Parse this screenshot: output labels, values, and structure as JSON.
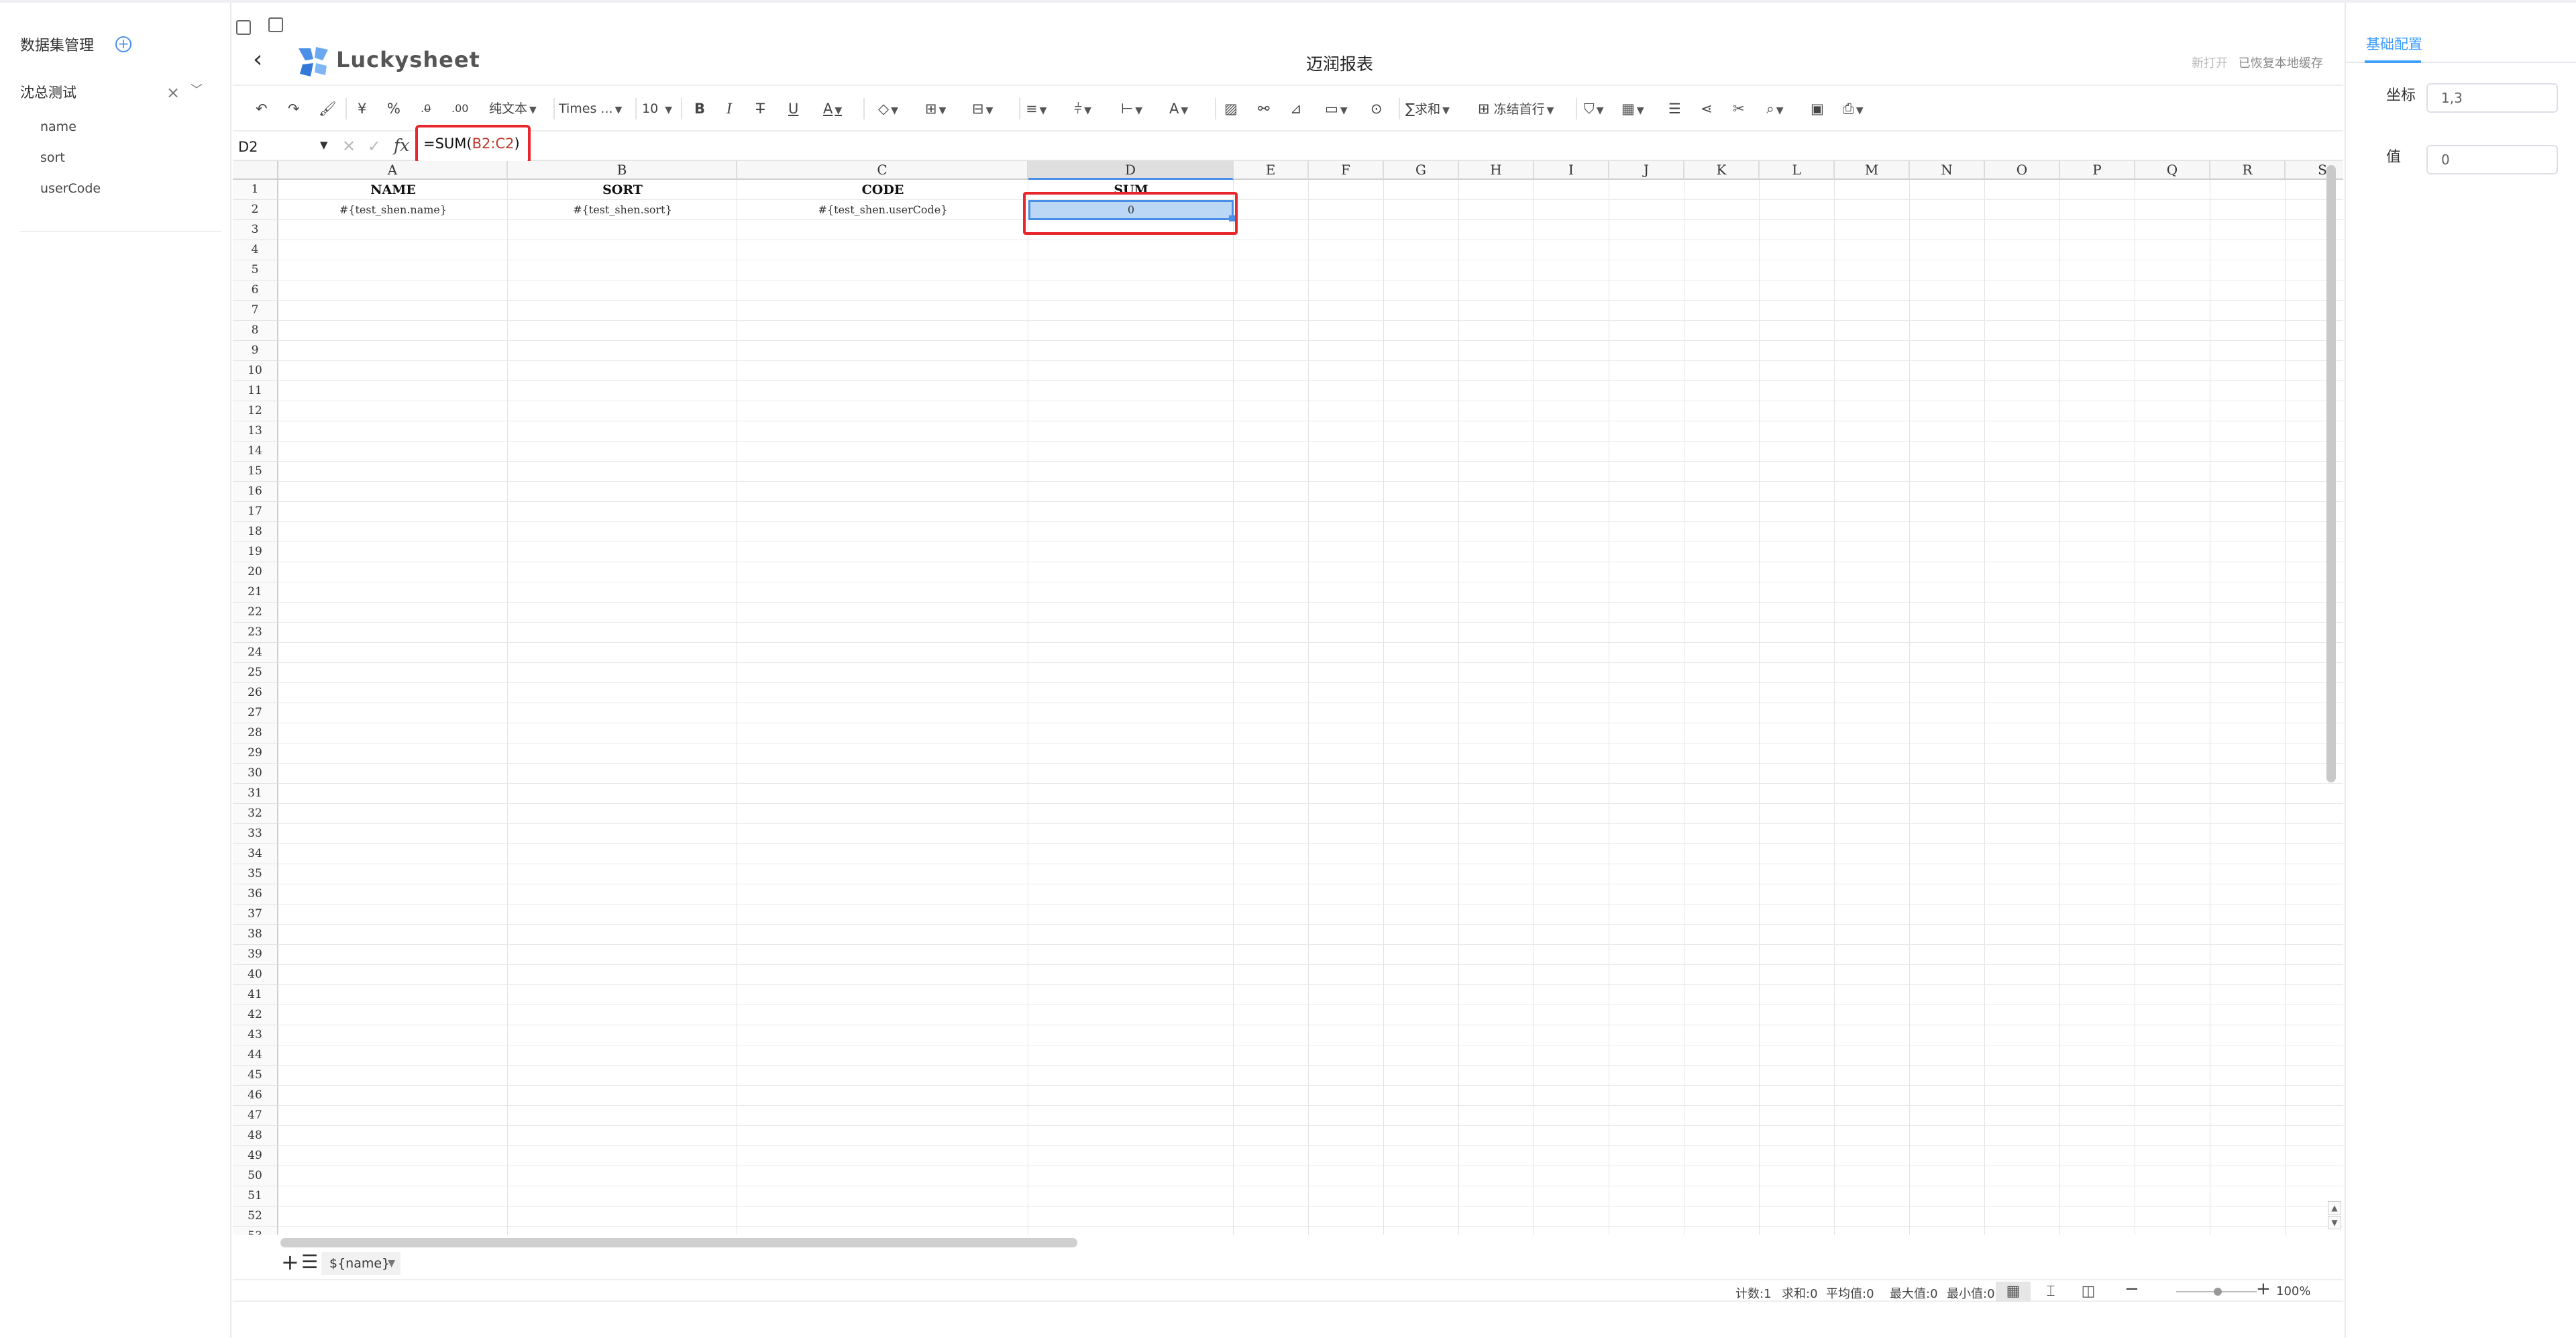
{
  "left_panel": {
    "title": "数据集管理",
    "add_icon": "plus-circle-icon",
    "dataset": {
      "name": "沈总测试",
      "fields": [
        "name",
        "sort",
        "userCode"
      ]
    }
  },
  "header": {
    "logo_text": "Luckysheet",
    "page_title": "迈润报表",
    "status_left": "新打开",
    "status_right": "已恢复本地缓存"
  },
  "toolbar": {
    "format_label": "纯文本",
    "font_label": "Times ...",
    "size_label": "10",
    "sum_label": "求和",
    "freeze_label": "冻结首行"
  },
  "formula_bar": {
    "cell_ref": "D2",
    "fx": "fx",
    "formula_prefix": "=SUM(",
    "formula_ref": "B2:C2",
    "formula_suffix": ")"
  },
  "grid": {
    "columns": [
      "A",
      "B",
      "C",
      "D",
      "E",
      "F",
      "G",
      "H",
      "I",
      "J",
      "K",
      "L",
      "M",
      "N",
      "O",
      "P",
      "Q",
      "R",
      "S"
    ],
    "selected_column": "D",
    "row_count": 53,
    "cells": {
      "A1": "NAME",
      "B1": "SORT",
      "C1": "CODE",
      "D1": "SUM",
      "A2": "#{test_shen.name}",
      "B2": "#{test_shen.sort}",
      "C2": "#{test_shen.userCode}",
      "D2": "0"
    },
    "selected_cell": "D2"
  },
  "sheet_tabs": {
    "active_tab": "${name}"
  },
  "status_bar": {
    "count": "计数:1",
    "sum": "求和:0",
    "avg": "平均值:0",
    "max": "最大值:0",
    "min": "最小值:0",
    "zoom": "100%"
  },
  "right_panel": {
    "tab_label": "基础配置",
    "coord_label": "坐标",
    "coord_value": "1,3",
    "value_label": "值",
    "value_value": "0"
  },
  "colors": {
    "accent": "#409eff",
    "selection": "#4a8fe7",
    "highlight_border": "#e8262d"
  }
}
